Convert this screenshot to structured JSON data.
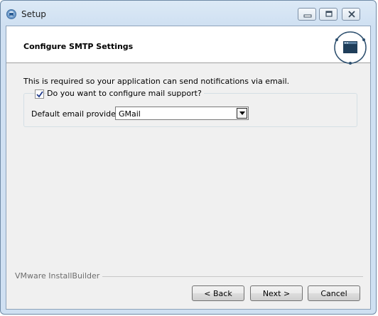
{
  "window": {
    "title": "Setup"
  },
  "header": {
    "title": "Configure SMTP Settings",
    "logo_icon": "installer-window-icon"
  },
  "content": {
    "intro_text": "This is required so your application can send notifications via email.",
    "mail_support_checkbox": {
      "label": "Do you want to configure mail support?",
      "checked": true
    },
    "provider": {
      "label": "Default email provider:",
      "selected_value": "GMail"
    }
  },
  "footer": {
    "brand": "VMware InstallBuilder",
    "back_label": "< Back",
    "next_label": "Next >",
    "cancel_label": "Cancel"
  },
  "colors": {
    "titlebar": "#dce9f6",
    "panel": "#f0f0f0",
    "header": "#ffffff",
    "logo_ring": "#2d4f6e"
  }
}
